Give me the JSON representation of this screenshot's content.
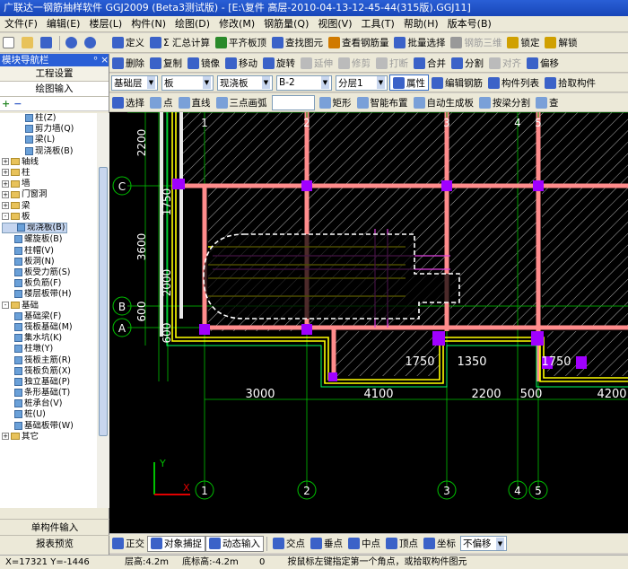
{
  "window": {
    "title": "广联达一钢筋抽样软件 GGJ2009 (Beta3测试版) - [E:\\复件 高层-2010-04-13-12-45-44(315版).GGJ11]"
  },
  "menu": [
    "文件(F)",
    "编辑(E)",
    "楼层(L)",
    "构件(N)",
    "绘图(D)",
    "修改(M)",
    "钢筋量(Q)",
    "视图(V)",
    "工具(T)",
    "帮助(H)",
    "版本号(B)"
  ],
  "toolbar1": [
    "定义",
    "Σ 汇总计算",
    "平齐板顶",
    "查找图元",
    "查看钢筋量",
    "批量选择",
    "钢筋三维",
    "锁定",
    "解锁"
  ],
  "toolbar2": [
    "删除",
    "复制",
    "镜像",
    "移动",
    "旋转",
    "延伸",
    "修剪",
    "打断",
    "合并",
    "分割",
    "对齐",
    "偏移"
  ],
  "selectors": {
    "floor": "基础层",
    "category": "板",
    "type": "现浇板",
    "name": "B-2",
    "layer": "分层1"
  },
  "toolbar3_btns": [
    "属性",
    "编辑钢筋",
    "构件列表",
    "拾取构件"
  ],
  "draw_toolbar": [
    "选择",
    "点",
    "直线",
    "三点画弧",
    "矩形",
    "智能布置",
    "自动生成板",
    "按梁分割",
    "查"
  ],
  "nav": {
    "title": "模块导航栏",
    "pin": "ᵒ ×",
    "btn1": "工程设置",
    "btn2": "绘图输入",
    "btn3": "单构件输入",
    "btn4": "报表预览"
  },
  "tree": [
    {
      "label": "柱(Z)",
      "level": 2,
      "kind": "leaf"
    },
    {
      "label": "剪力墙(Q)",
      "level": 2,
      "kind": "leaf"
    },
    {
      "label": "梁(L)",
      "level": 2,
      "kind": "leaf"
    },
    {
      "label": "现浇板(B)",
      "level": 2,
      "kind": "leaf"
    },
    {
      "label": "轴线",
      "level": 0,
      "kind": "folder",
      "toggle": "+"
    },
    {
      "label": "柱",
      "level": 0,
      "kind": "folder",
      "toggle": "+"
    },
    {
      "label": "墙",
      "level": 0,
      "kind": "folder",
      "toggle": "+"
    },
    {
      "label": "门窗洞",
      "level": 0,
      "kind": "folder",
      "toggle": "+"
    },
    {
      "label": "梁",
      "level": 0,
      "kind": "folder",
      "toggle": "+"
    },
    {
      "label": "板",
      "level": 0,
      "kind": "folder",
      "toggle": "-"
    },
    {
      "label": "现浇板(B)",
      "level": 1,
      "kind": "leaf",
      "selected": true
    },
    {
      "label": "螺旋板(B)",
      "level": 1,
      "kind": "leaf"
    },
    {
      "label": "柱帽(V)",
      "level": 1,
      "kind": "leaf"
    },
    {
      "label": "板洞(N)",
      "level": 1,
      "kind": "leaf"
    },
    {
      "label": "板受力筋(S)",
      "level": 1,
      "kind": "leaf"
    },
    {
      "label": "板负筋(F)",
      "level": 1,
      "kind": "leaf"
    },
    {
      "label": "楼层板带(H)",
      "level": 1,
      "kind": "leaf"
    },
    {
      "label": "基础",
      "level": 0,
      "kind": "folder",
      "toggle": "-"
    },
    {
      "label": "基础梁(F)",
      "level": 1,
      "kind": "leaf"
    },
    {
      "label": "筏板基础(M)",
      "level": 1,
      "kind": "leaf"
    },
    {
      "label": "集水坑(K)",
      "level": 1,
      "kind": "leaf"
    },
    {
      "label": "柱墩(Y)",
      "level": 1,
      "kind": "leaf"
    },
    {
      "label": "筏板主筋(R)",
      "level": 1,
      "kind": "leaf"
    },
    {
      "label": "筏板负筋(X)",
      "level": 1,
      "kind": "leaf"
    },
    {
      "label": "独立基础(P)",
      "level": 1,
      "kind": "leaf"
    },
    {
      "label": "条形基础(T)",
      "level": 1,
      "kind": "leaf"
    },
    {
      "label": "桩承台(V)",
      "level": 1,
      "kind": "leaf"
    },
    {
      "label": "桩(U)",
      "level": 1,
      "kind": "leaf"
    },
    {
      "label": "基础板带(W)",
      "level": 1,
      "kind": "leaf"
    },
    {
      "label": "其它",
      "level": 0,
      "kind": "folder",
      "toggle": "+"
    }
  ],
  "status_buttons": [
    "正交",
    "对象捕捉",
    "动态输入",
    "交点",
    "垂点",
    "中点",
    "顶点",
    "坐标",
    "不偏移"
  ],
  "coordbar": {
    "coords": "X=17321 Y=-1446",
    "floor_height": "层高:4.2m",
    "bottom_elev": "底标高:-4.2m",
    "zero": "0",
    "hint": "按鼠标左键指定第一个角点，或拾取构件图元"
  },
  "drawing": {
    "axis_labels_top": [
      "1",
      "2",
      "3",
      "4",
      "5"
    ],
    "axis_labels_bottom": [
      "1",
      "2",
      "3",
      "4",
      "5"
    ],
    "axis_labels_left": [
      "C",
      "B",
      "A"
    ],
    "dims_bottom": [
      "3000",
      "4100",
      "2200",
      "500",
      "4200"
    ],
    "dims_inner": [
      "1750",
      "1350",
      "1750"
    ],
    "dims_left": [
      "2200",
      "3600",
      "1750",
      "2000",
      "600",
      "600"
    ],
    "ucs_x": "X",
    "ucs_y": "Y"
  },
  "colors": {
    "beam": "#ff8080",
    "wall": "#ffffff",
    "slab_hatch": "#ffffff",
    "column": "#c000ff",
    "rebar": "#ffff00",
    "axis": "#00ff00",
    "dim": "#ffffff"
  }
}
